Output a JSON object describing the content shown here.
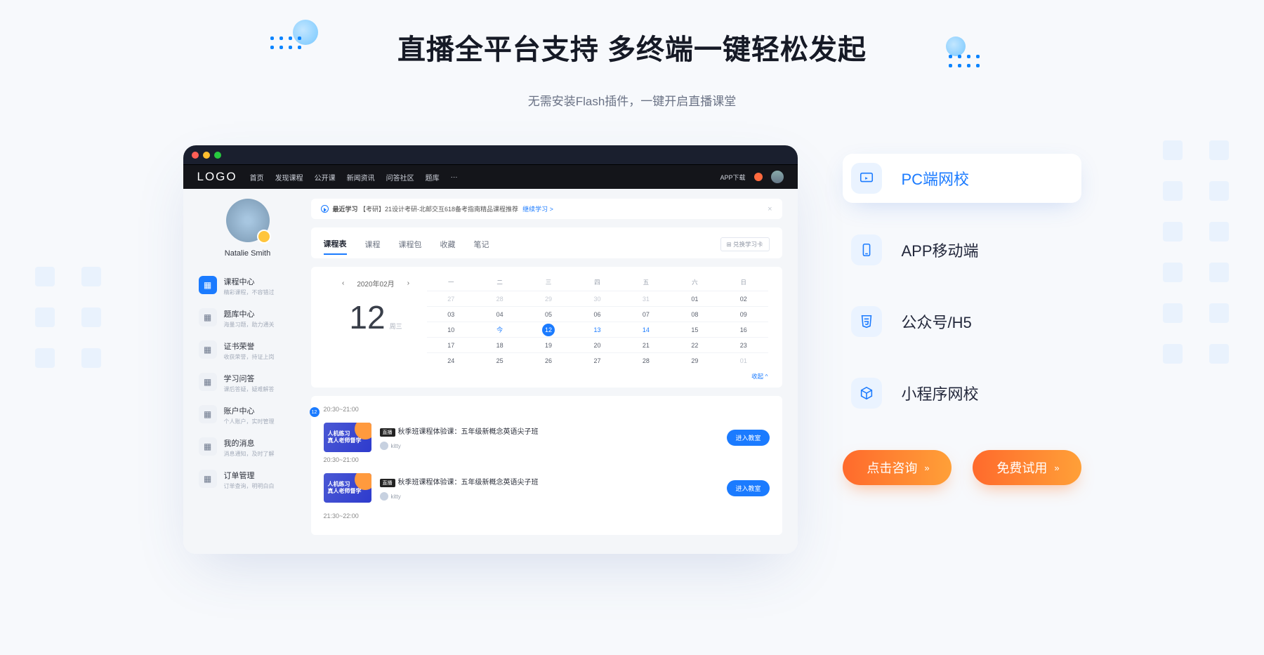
{
  "hero": {
    "title": "直播全平台支持 多终端一键轻松发起",
    "subtitle": "无需安装Flash插件，一键开启直播课堂"
  },
  "window": {
    "logo": "LOGO",
    "nav": [
      "首页",
      "发现课程",
      "公开课",
      "新闻资讯",
      "问答社区",
      "题库",
      "···"
    ],
    "app_download": "APP下载",
    "user_name": "Natalie Smith",
    "side_menu": [
      {
        "title": "课程中心",
        "sub": "精彩课程，不容错过"
      },
      {
        "title": "题库中心",
        "sub": "海量习题，助力通关"
      },
      {
        "title": "证书荣誉",
        "sub": "收获荣誉，持证上岗"
      },
      {
        "title": "学习问答",
        "sub": "课后答疑，疑难解答"
      },
      {
        "title": "账户中心",
        "sub": "个人账户，实时管理"
      },
      {
        "title": "我的消息",
        "sub": "消息通知，及时了解"
      },
      {
        "title": "订单管理",
        "sub": "订单查询，明明白白"
      }
    ],
    "notice": {
      "label": "最近学习",
      "text": "【考研】21设计考研-北邮交互618备考指南精品课程推荐",
      "link": "继续学习 >"
    },
    "tabs": [
      "课程表",
      "课程",
      "课程包",
      "收藏",
      "笔记"
    ],
    "tabs_btn": "兑换学习卡",
    "calendar": {
      "month": "2020年02月",
      "big_day": "12",
      "big_week": "周三",
      "weekdays": [
        "一",
        "二",
        "三",
        "四",
        "五",
        "六",
        "日"
      ],
      "cells": [
        [
          "27",
          "28",
          "29",
          "30",
          "31",
          "01",
          "02"
        ],
        [
          "03",
          "04",
          "05",
          "06",
          "07",
          "08",
          "09"
        ],
        [
          "10",
          "今",
          "12",
          "13",
          "14",
          "15",
          "16"
        ],
        [
          "17",
          "18",
          "19",
          "20",
          "21",
          "22",
          "23"
        ],
        [
          "24",
          "25",
          "26",
          "27",
          "28",
          "29",
          "01"
        ]
      ],
      "collapse": "收起 ^"
    },
    "schedule": {
      "dot": "12",
      "blocks": [
        {
          "time": "20:30~21:00",
          "thumb_l1": "人机练习",
          "thumb_l2": "真人老师督学",
          "tag": "直播",
          "title": "秋季班课程体验课：五年级新概念英语尖子班",
          "teacher": "kitty",
          "btn": "进入教室"
        },
        {
          "time": "20:30~21:00",
          "thumb_l1": "人机练习",
          "thumb_l2": "真人老师督学",
          "tag": "直播",
          "title": "秋季班课程体验课：五年级新概念英语尖子班",
          "teacher": "kitty",
          "btn": "进入教室"
        }
      ],
      "next_time": "21:30~22:00"
    }
  },
  "features": [
    {
      "id": "pc",
      "label": "PC端网校"
    },
    {
      "id": "app",
      "label": "APP移动端"
    },
    {
      "id": "h5",
      "label": "公众号/H5"
    },
    {
      "id": "mini",
      "label": "小程序网校"
    }
  ],
  "cta": {
    "consult": "点击咨询",
    "trial": "免费试用"
  }
}
